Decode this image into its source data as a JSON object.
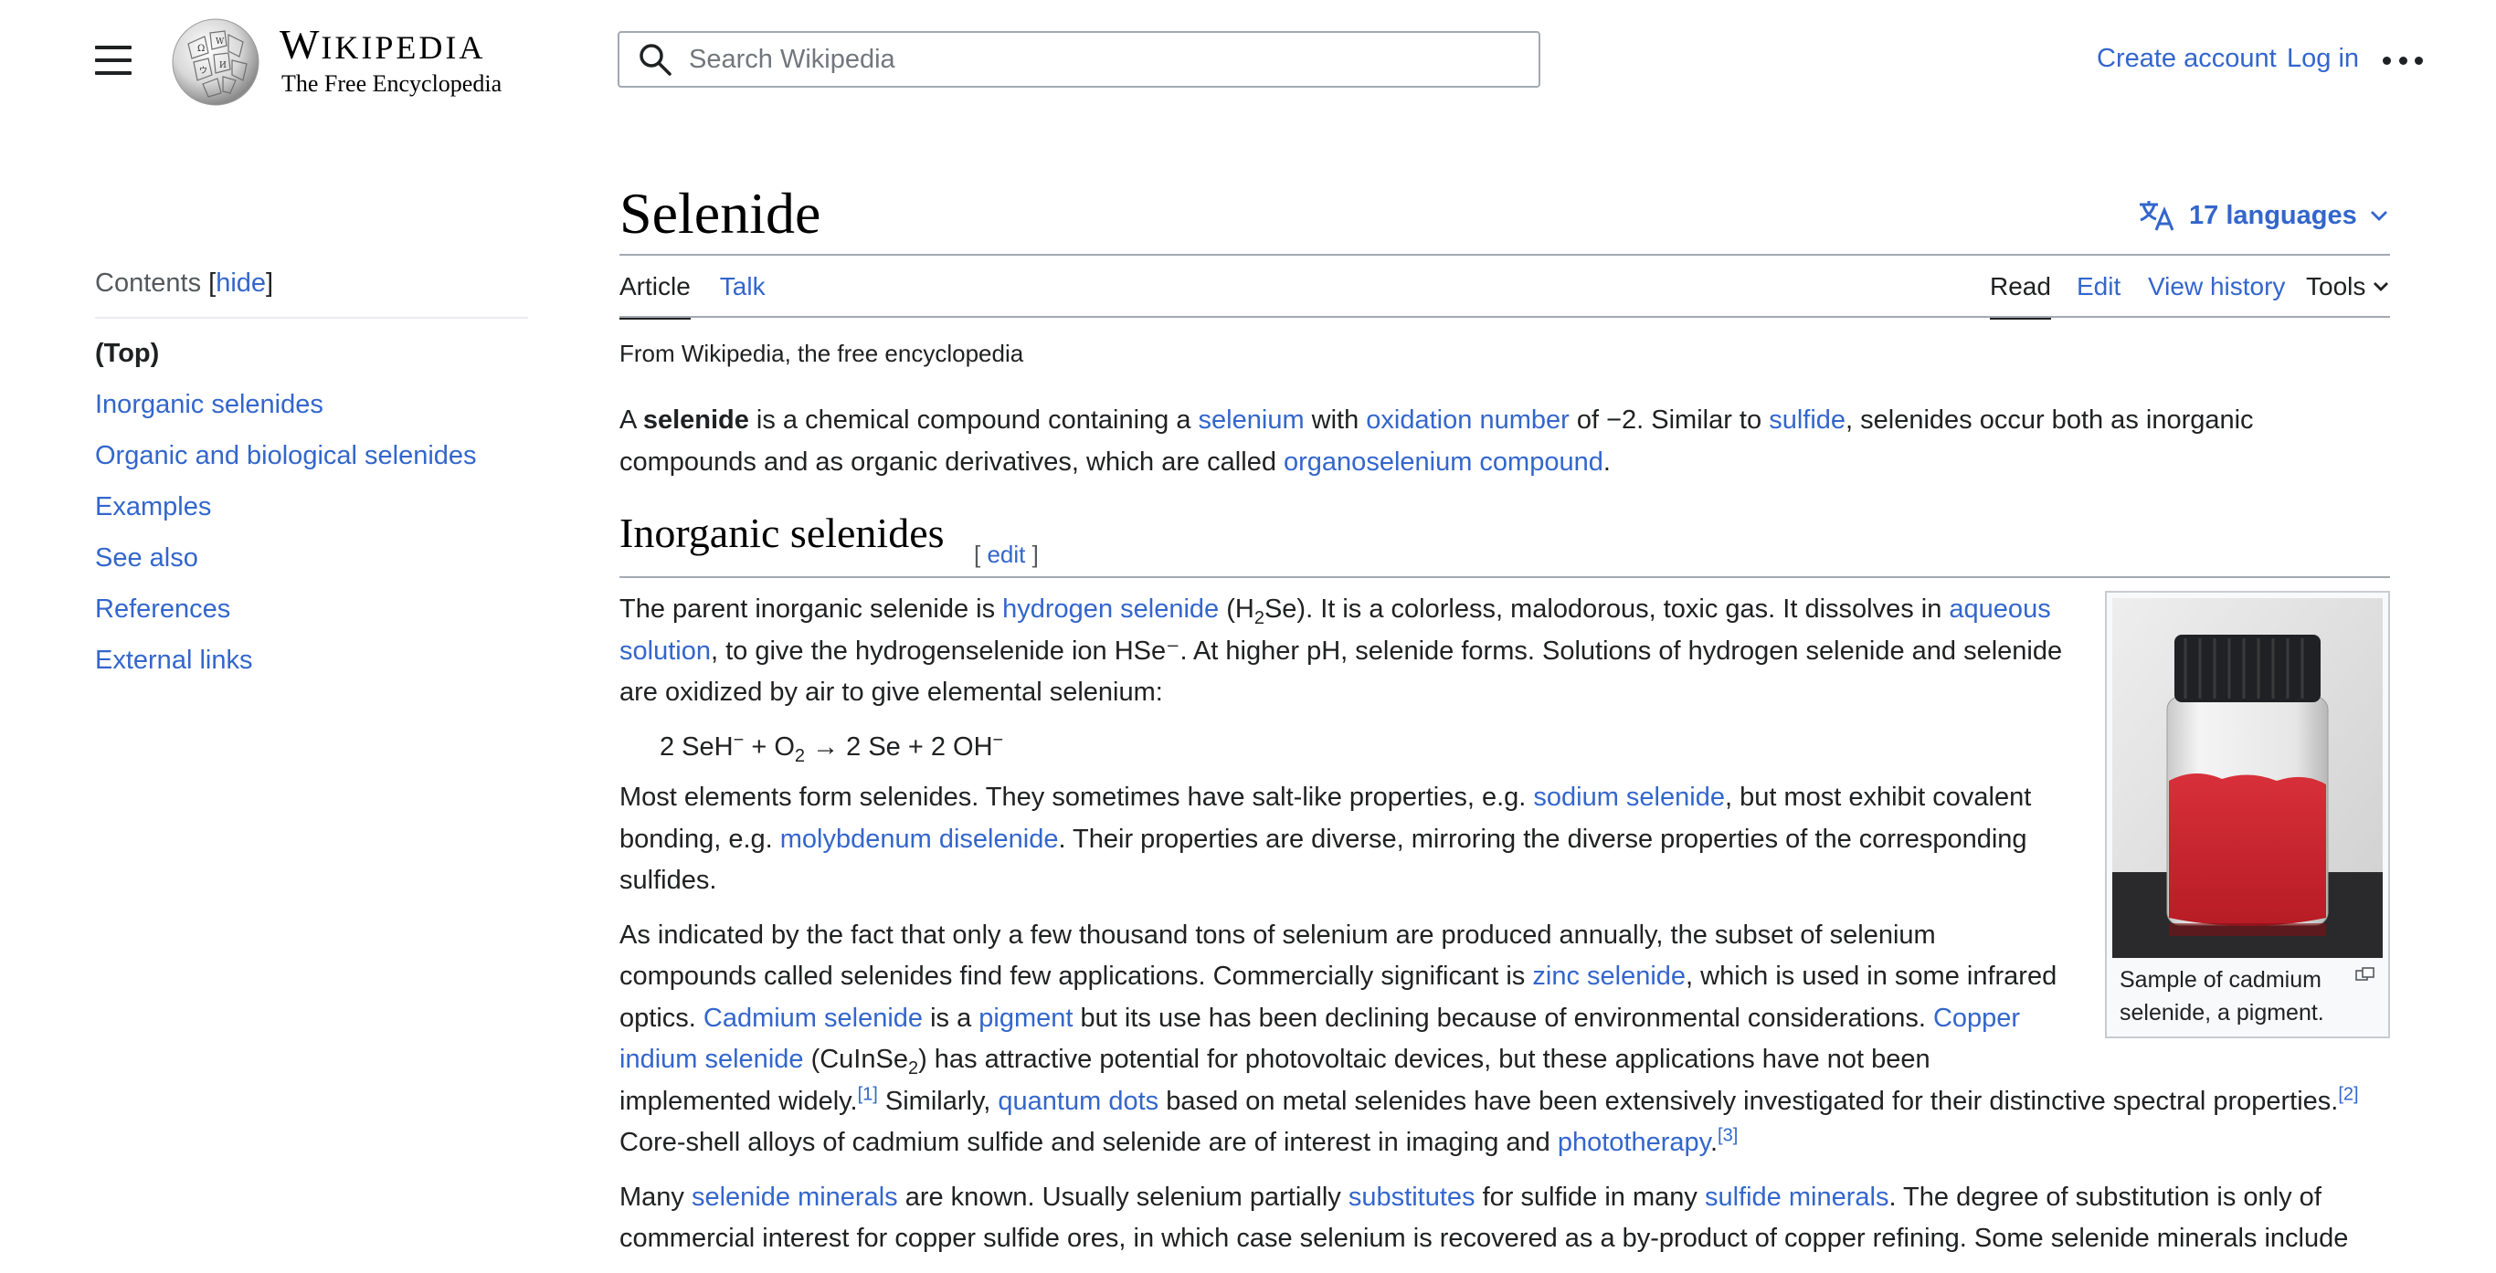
{
  "header": {
    "menu_icon": "hamburger-menu-icon",
    "wordmark_title_cap": "W",
    "wordmark_title_rest": "IKIPEDIA",
    "wordmark_tagline": "The Free Encyclopedia",
    "search_placeholder": "Search Wikipedia",
    "create_account": "Create account",
    "log_in": "Log in"
  },
  "toc": {
    "heading": "Contents",
    "toggle_open": "[",
    "toggle": "hide",
    "toggle_close": "]",
    "items": [
      "(Top)",
      "Inorganic selenides",
      "Organic and biological selenides",
      "Examples",
      "See also",
      "References",
      "External links"
    ]
  },
  "article": {
    "title": "Selenide",
    "languages": "17 languages",
    "tabs": {
      "article": "Article",
      "talk": "Talk",
      "read": "Read",
      "edit": "Edit",
      "history": "View history",
      "tools": "Tools"
    },
    "tagline": "From Wikipedia, the free encyclopedia",
    "intro": {
      "t1": "A ",
      "bold": "selenide",
      "t2": " is a chemical compound containing a ",
      "l1": "selenium",
      "t3": " with ",
      "l2": "oxidation number",
      "t4": " of −2. Similar to ",
      "l3": "sulfide",
      "t5": ", selenides occur both as inorganic compounds and as organic derivatives, which are called ",
      "l4": "organoselenium compound",
      "t6": "."
    },
    "section1": {
      "heading": "Inorganic selenides",
      "edit_open": "[ ",
      "edit": "edit",
      "edit_close": " ]"
    },
    "figure": {
      "caption": "Sample of cadmium selenide, a pigment."
    },
    "p1": {
      "t1": "The parent inorganic selenide is ",
      "l1": "hydrogen selenide",
      "t2": " (H",
      "sub1": "2",
      "t3": "Se). It is a colorless, malodorous, toxic gas. It dissolves in ",
      "l2": "aqueous solution",
      "t4": ", to give the hydrogenselenide ion HSe⁻. At higher pH, selenide forms. Solutions of hydrogen selenide and selenide are oxidized by air to give elemental selenium:"
    },
    "equation": {
      "a": "2 SeH",
      "sup1": "−",
      "b": " + O",
      "sub1": "2",
      "c": " → 2 Se + 2 OH",
      "sup2": "−"
    },
    "p2": {
      "t1": "Most elements form selenides. They sometimes have salt-like properties, e.g. ",
      "l1": "sodium selenide",
      "t2": ", but most exhibit covalent bonding, e.g. ",
      "l2": "molybdenum diselenide",
      "t3": ". Their properties are diverse, mirroring the diverse properties of the corresponding sulfides."
    },
    "p3": {
      "t1": "As indicated by the fact that only a few thousand tons of selenium are produced annually, the subset of selenium compounds called selenides find few applications. Commercially significant is ",
      "l1": "zinc selenide",
      "t2": ", which is used in some infrared optics. ",
      "l2": "Cadmium selenide",
      "t3": " is a ",
      "l3": "pigment",
      "t4": " but its use has been declining because of environmental considerations. ",
      "l4": "Copper indium selenide",
      "t5": " (CuInSe",
      "sub1": "2",
      "t6": ") has attractive potential for photovoltaic devices, but these applications have not been implemented widely.",
      "ref1": "[1]",
      "t7": " Similarly, ",
      "l5": "quantum dots",
      "t8": " based on metal selenides have been extensively investigated for their distinctive spectral properties.",
      "ref2": "[2]",
      "t9": " Core-shell alloys of cadmium sulfide and selenide are of interest in imaging and ",
      "l6": "phototherapy",
      "t10": ".",
      "ref3": "[3]"
    },
    "p4": {
      "t1": "Many ",
      "l1": "selenide minerals",
      "t2": " are known. Usually selenium partially ",
      "l2": "substitutes",
      "t3": " for sulfide in many ",
      "l3": "sulfide minerals",
      "t4": ". The degree of substitution is only of commercial interest for copper sulfide ores, in which case selenium is recovered as a by-product of copper refining. Some selenide minerals include"
    }
  },
  "colors": {
    "link": "#3366cc",
    "text": "#202122",
    "rule": "#a2a9b1"
  }
}
